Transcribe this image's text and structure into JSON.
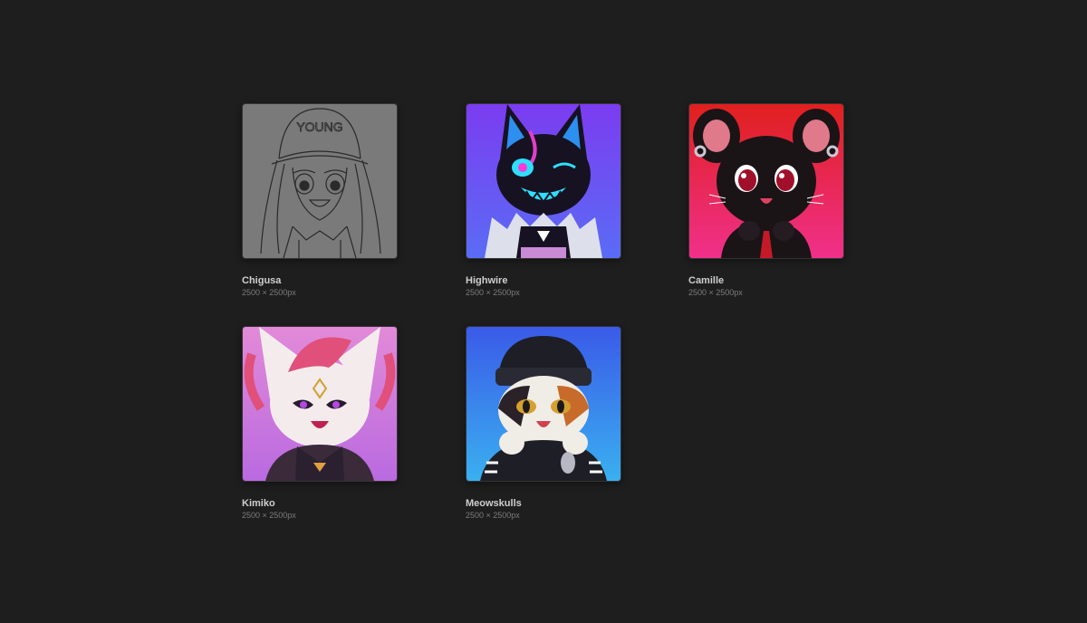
{
  "gallery": {
    "items": [
      {
        "name": "Chigusa",
        "dimensions": "2500 × 2500px",
        "bg_color": "#7a7a7a",
        "thumbnail_icon": "sketch-girl-portrait",
        "cap_text": "YOUNG"
      },
      {
        "name": "Highwire",
        "dimensions": "2500 × 2500px",
        "bg_color": "#7b3cf0",
        "thumbnail_icon": "black-cat-neon-portrait"
      },
      {
        "name": "Camille",
        "dimensions": "2500 × 2500px",
        "bg_color": "#e0203a",
        "thumbnail_icon": "black-mouse-portrait"
      },
      {
        "name": "Kimiko",
        "dimensions": "2500 × 2500px",
        "bg_color": "#d37ad6",
        "thumbnail_icon": "white-fox-portrait"
      },
      {
        "name": "Meowskulls",
        "dimensions": "2500 × 2500px",
        "bg_color": "#3a62e8",
        "thumbnail_icon": "calico-cat-beanie-portrait"
      }
    ]
  }
}
